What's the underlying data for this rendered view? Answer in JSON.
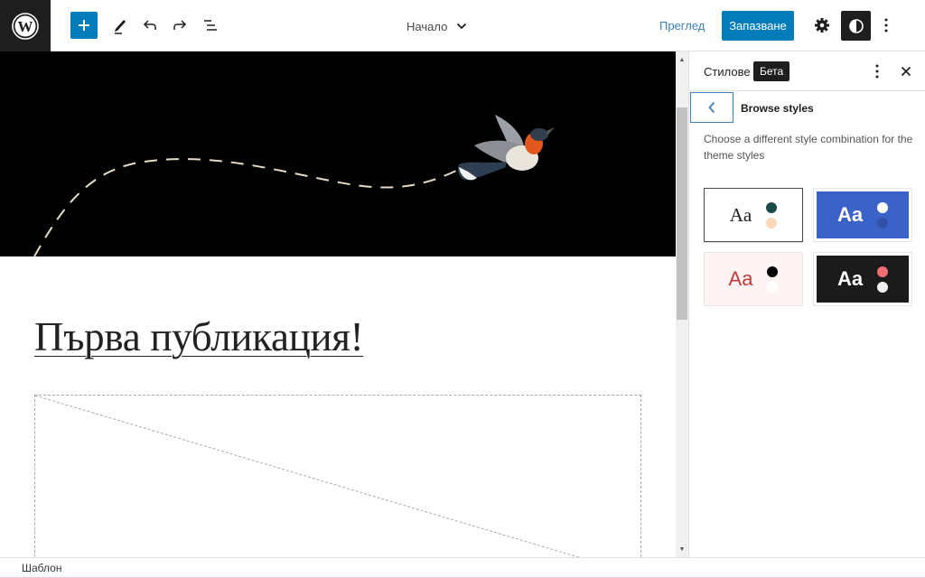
{
  "topbar": {
    "logo": "wordpress-icon",
    "add_block_icon": "plus-icon",
    "tools_icon": "pencil-icon",
    "undo_icon": "undo-icon",
    "redo_icon": "redo-icon",
    "list_view_icon": "list-view-icon",
    "template_selector": "Начало",
    "preview_label": "Преглед",
    "save_label": "Запазване",
    "settings_icon": "gear-icon",
    "styles_icon": "contrast-icon",
    "more_icon": "more-vertical-icon",
    "accent_color": "#007cba"
  },
  "canvas": {
    "post_title": "Първа публикация!",
    "hero_background": "#000000"
  },
  "sidebar": {
    "title": "Стилове",
    "badge": "Бета",
    "nav_title": "Browse styles",
    "description": "Choose a different style combination for the theme styles",
    "variations": [
      {
        "label": "Aa",
        "background": "#ffffff",
        "text_color": "#1e1e1e",
        "dots": [
          "#1a4a4a",
          "#fcd9b8"
        ],
        "selected": true
      },
      {
        "label": "Aa",
        "background": "#3b63c7",
        "text_color": "#ffffff",
        "dots": [
          "#ffffff",
          "#3252a8"
        ],
        "selected": false
      },
      {
        "label": "Aa",
        "background": "#fdf4f3",
        "text_color": "#c0393b",
        "dots": [
          "#000000",
          "#ffffff"
        ],
        "selected": false
      },
      {
        "label": "Aa",
        "background": "#1b1b1b",
        "text_color": "#ffffff",
        "dots": [
          "#f26d72",
          "#f2f2f2"
        ],
        "selected": false
      }
    ]
  },
  "footer": {
    "breadcrumb": "Шаблон"
  }
}
